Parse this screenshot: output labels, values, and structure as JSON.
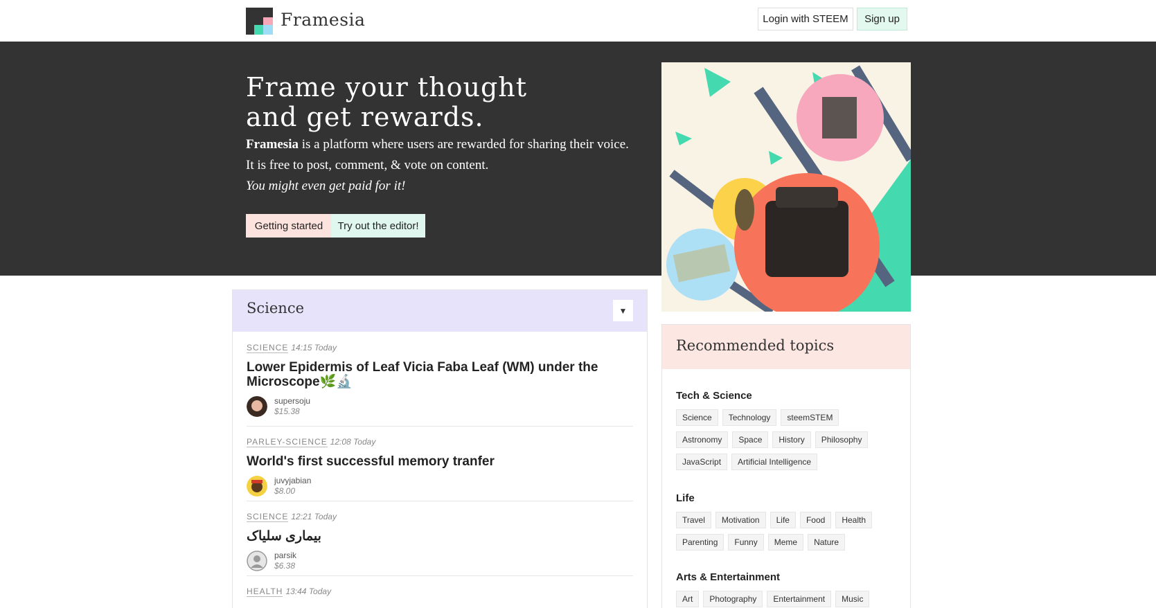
{
  "header": {
    "brand": "Framesia",
    "login_label": "Login with STEEM",
    "signup_label": "Sign up"
  },
  "hero": {
    "title_line1": "Frame your thought",
    "title_line2": "and get rewards.",
    "p1_brand": "Framesia",
    "p1_rest": " is a platform where users are rewarded for sharing their voice.",
    "p2": "It is free to post, comment, & vote on content.",
    "p3": "You might even get paid for it!",
    "btn_start": "Getting started",
    "btn_editor": "Try out the editor!"
  },
  "feed": {
    "title": "Science",
    "dropdown_icon": "▼",
    "posts": [
      {
        "tag": "SCIENCE",
        "time": "14:15 Today",
        "title": "Lower Epidermis of Leaf Vicia Faba Leaf (WM) under the Microscope🌿🔬",
        "author": "supersoju",
        "payout": "$15.38"
      },
      {
        "tag": "PARLEY-SCIENCE",
        "time": "12:08 Today",
        "title": "World's first successful memory tranfer",
        "author": "juvyjabian",
        "payout": "$8.00"
      },
      {
        "tag": "SCIENCE",
        "time": "12:21 Today",
        "title": "بیماری سلیاک",
        "author": "parsik",
        "payout": "$6.38"
      },
      {
        "tag": "HEALTH",
        "time": "13:44 Today"
      }
    ]
  },
  "sidebar": {
    "title": "Recommended topics",
    "groups": [
      {
        "name": "Tech & Science",
        "topics": [
          "Science",
          "Technology",
          "steemSTEM",
          "Astronomy",
          "Space",
          "History",
          "Philosophy",
          "JavaScript",
          "Artificial Intelligence"
        ]
      },
      {
        "name": "Life",
        "topics": [
          "Travel",
          "Motivation",
          "Life",
          "Food",
          "Health",
          "Parenting",
          "Funny",
          "Meme",
          "Nature"
        ]
      },
      {
        "name": "Arts & Entertainment",
        "topics": [
          "Art",
          "Photography",
          "Entertainment",
          "Music"
        ]
      }
    ]
  },
  "colors": {
    "hero_bg": "#333333",
    "feed_head": "#e6e3fa",
    "side_head": "#fde7e2",
    "mint": "#dff7ee",
    "pink": "#fde3de"
  }
}
